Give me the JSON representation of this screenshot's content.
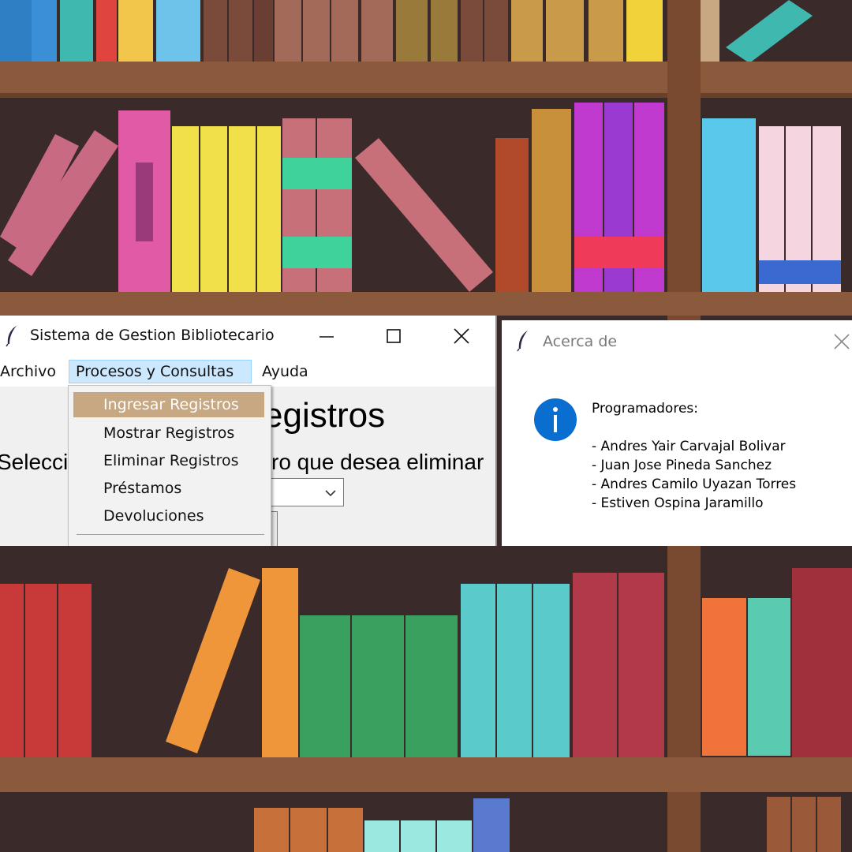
{
  "main_window": {
    "title": "Sistema de Gestion Bibliotecario",
    "menu": {
      "archivo": "Archivo",
      "procesos": "Procesos y Consultas",
      "ayuda": "Ayuda"
    },
    "heading": "egistros",
    "prompt": "Selecci",
    "prompt_tail": "ro que desea eliminar",
    "dropdown_items": [
      "Ingresar Registros",
      "Mostrar Registros",
      "Eliminar Registros",
      "Préstamos",
      "Devoluciones"
    ]
  },
  "about_window": {
    "title": "Acerca de",
    "heading": "Programadores:",
    "developers": [
      "- Andres Yair Carvajal Bolivar",
      "- Juan Jose Pineda Sanchez",
      "- Andres Camilo Uyazan Torres",
      "- Estiven Ospina Jaramillo"
    ]
  },
  "colors": {
    "shelf_wood": "#8b5a3c",
    "shelf_back": "#3b2a2a",
    "menu_highlight": "#c8a882",
    "menu_active": "#cce8ff",
    "info_blue": "#0a6ed1"
  },
  "icons": {
    "app": "feather-icon",
    "about": "feather-icon",
    "info": "info-icon"
  }
}
